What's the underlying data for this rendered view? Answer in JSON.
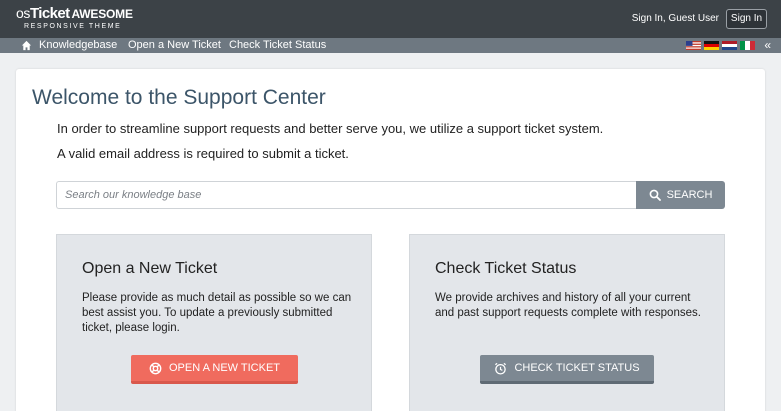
{
  "header": {
    "logo_os": "os",
    "logo_ticket": "Ticket",
    "logo_awesome": "AWESOME",
    "logo_subtitle": "RESPONSIVE THEME",
    "user_text": "Sign In, Guest User",
    "signin_label": "Sign In"
  },
  "nav": {
    "items": [
      {
        "label": "Knowledgebase"
      },
      {
        "label": "Open a New Ticket"
      },
      {
        "label": "Check Ticket Status"
      }
    ],
    "flags": [
      "us-flag-icon",
      "de-flag-icon",
      "nl-flag-icon",
      "it-flag-icon"
    ],
    "collapse_label": "«"
  },
  "main": {
    "title": "Welcome to the Support Center",
    "intro_line1": "In order to streamline support requests and better serve you, we utilize a support ticket system.",
    "intro_line2": "A valid email address is required to submit a ticket.",
    "search": {
      "placeholder": "Search our knowledge base",
      "value": "",
      "button_label": "SEARCH"
    },
    "panels": [
      {
        "title": "Open a New Ticket",
        "text": "Please provide as much detail as possible so we can best assist you. To update a previously submitted ticket, please login.",
        "button_label": "OPEN A NEW TICKET",
        "button_icon": "life-ring-icon"
      },
      {
        "title": "Check Ticket Status",
        "text": "We provide archives and history of all your current and past support requests complete with responses.",
        "button_label": "CHECK TICKET STATUS",
        "button_icon": "alarm-clock-icon"
      }
    ]
  },
  "colors": {
    "header_bg": "#3c4247",
    "nav_bg": "#6e7881",
    "title_color": "#3c5569",
    "primary_button": "#f06b5e",
    "secondary_button": "#7d8892",
    "panel_bg": "#e3e6ea"
  }
}
